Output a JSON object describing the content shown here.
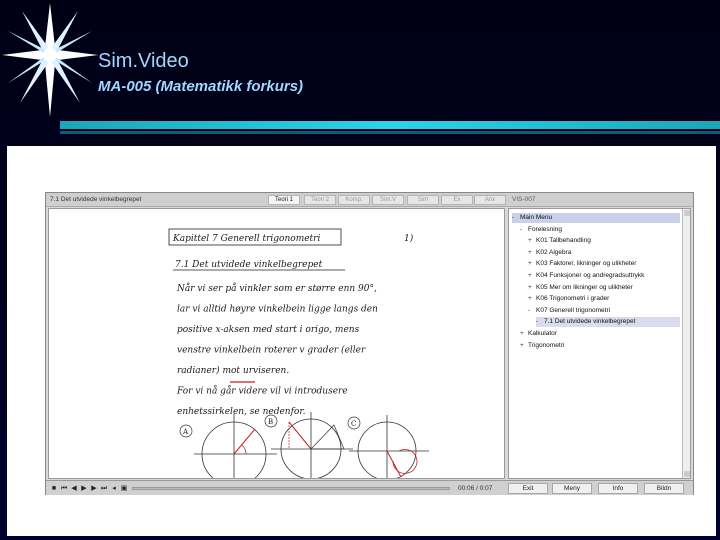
{
  "header": {
    "title": "Sim.Video",
    "subtitle": "MA-005 (Matematikk forkurs)"
  },
  "player": {
    "video_title": "7.1 Det utvidede vinkelbegrepet",
    "tabs": [
      "Teori 1",
      "Teori 2",
      "Komp.",
      "Sim.V",
      "Sim",
      "Ex",
      "Anx"
    ],
    "active_tab_index": 0,
    "menu_header": "VIS-007",
    "time": "00:06 / 0:07",
    "bottom_buttons": [
      "Exit",
      "Meny",
      "Info",
      "Bildn"
    ]
  },
  "menu": [
    {
      "label": "Main Menu",
      "expander": "-",
      "level": 0,
      "selected": true
    },
    {
      "label": "Forelesning",
      "expander": "-",
      "level": 1
    },
    {
      "label": "K01 Tallbehandling",
      "expander": "+",
      "level": 2
    },
    {
      "label": "K02 Algebra",
      "expander": "+",
      "level": 2
    },
    {
      "label": "K03 Faktorer, likninger og ulikheter",
      "expander": "+",
      "level": 2
    },
    {
      "label": "K04 Funksjoner og andregradsuttrykk",
      "expander": "+",
      "level": 2
    },
    {
      "label": "K05 Mer om likninger og ulikheter",
      "expander": "+",
      "level": 2
    },
    {
      "label": "K06 Trigonometri i grader",
      "expander": "+",
      "level": 2
    },
    {
      "label": "K07 Generell trigonometri",
      "expander": "-",
      "level": 2
    },
    {
      "label": "7.1 Det utvidede vinkelbegrepet",
      "expander": "-",
      "level": 3,
      "highlighted": true
    },
    {
      "label": "Kalkulator",
      "expander": "+",
      "level": 1
    },
    {
      "label": "Trigonometri",
      "expander": "+",
      "level": 1
    }
  ],
  "notes": {
    "heading": "Kapittel 7  Generell trigonometri",
    "page_number": "1)",
    "section": "7.1 Det utvidede vinkelbegrepet",
    "lines": [
      "Når vi ser på vinkler som er større enn 90°,",
      "lar vi alltid høyre vinkelbein ligge langs den",
      "positive x-aksen med start i origo, mens",
      "venstre vinkelbein roterer v grader (eller",
      "radianer) mot urviseren.",
      "For vi nå går videre vil vi introdusere",
      "enhetssirkelen, se nedenfor."
    ],
    "figure_labels": [
      "A",
      "B",
      "C"
    ]
  },
  "colors": {
    "accent_bar": "#1aa7b8",
    "header_text": "#9fd8ff",
    "ink": "#1a1a1a",
    "red_ink": "#c8201e"
  }
}
